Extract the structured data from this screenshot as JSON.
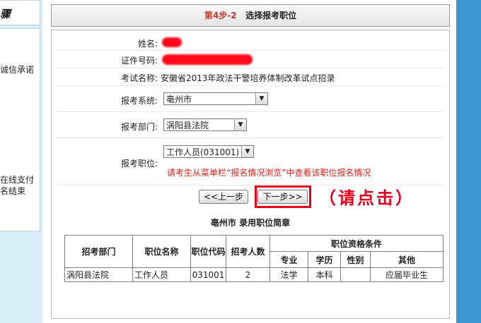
{
  "sidebar": {
    "heading": "骤",
    "item_integrity": "诚信承诺",
    "item_pay_line1": "在线支付",
    "item_pay_line2": "名结束"
  },
  "header": {
    "step_number": "第4步-2",
    "step_title": "选择报考职位"
  },
  "form": {
    "name_label": "姓名:",
    "id_label": "证件号码:",
    "exam_label": "考试名称:",
    "exam_value": "安徽省2013年政法干警培养体制改革试点招录",
    "system_label": "报考系统:",
    "system_value": "亳州市",
    "dept_label": "报考部门:",
    "dept_value": "涡阳县法院",
    "position_label": "报考职位:",
    "position_value": "工作人员(031001)",
    "notice": "请考生从菜单栏“报名情况浏览”中查看该职位报名情况"
  },
  "buttons": {
    "prev": "<<上一步",
    "next": "下一步>>",
    "hint": "（请点击）"
  },
  "table": {
    "title": "亳州市 录用职位简章",
    "headers": {
      "dept": "招考部门",
      "position": "职位名称",
      "code": "职位代码",
      "count": "招考人数",
      "qualifications": "职位资格条件",
      "major": "专业",
      "education": "学历",
      "gender": "性别",
      "other": "其他"
    },
    "rows": [
      {
        "dept": "涡阳县法院",
        "position": "工作人员",
        "code": "031001",
        "count": "2",
        "major": "法学",
        "education": "本科",
        "gender": "",
        "other": "应届毕业生"
      }
    ]
  },
  "colors": {
    "accent_blue": "#3a98cf",
    "highlight_red": "#e2001a",
    "notice_red": "#d0231c"
  }
}
